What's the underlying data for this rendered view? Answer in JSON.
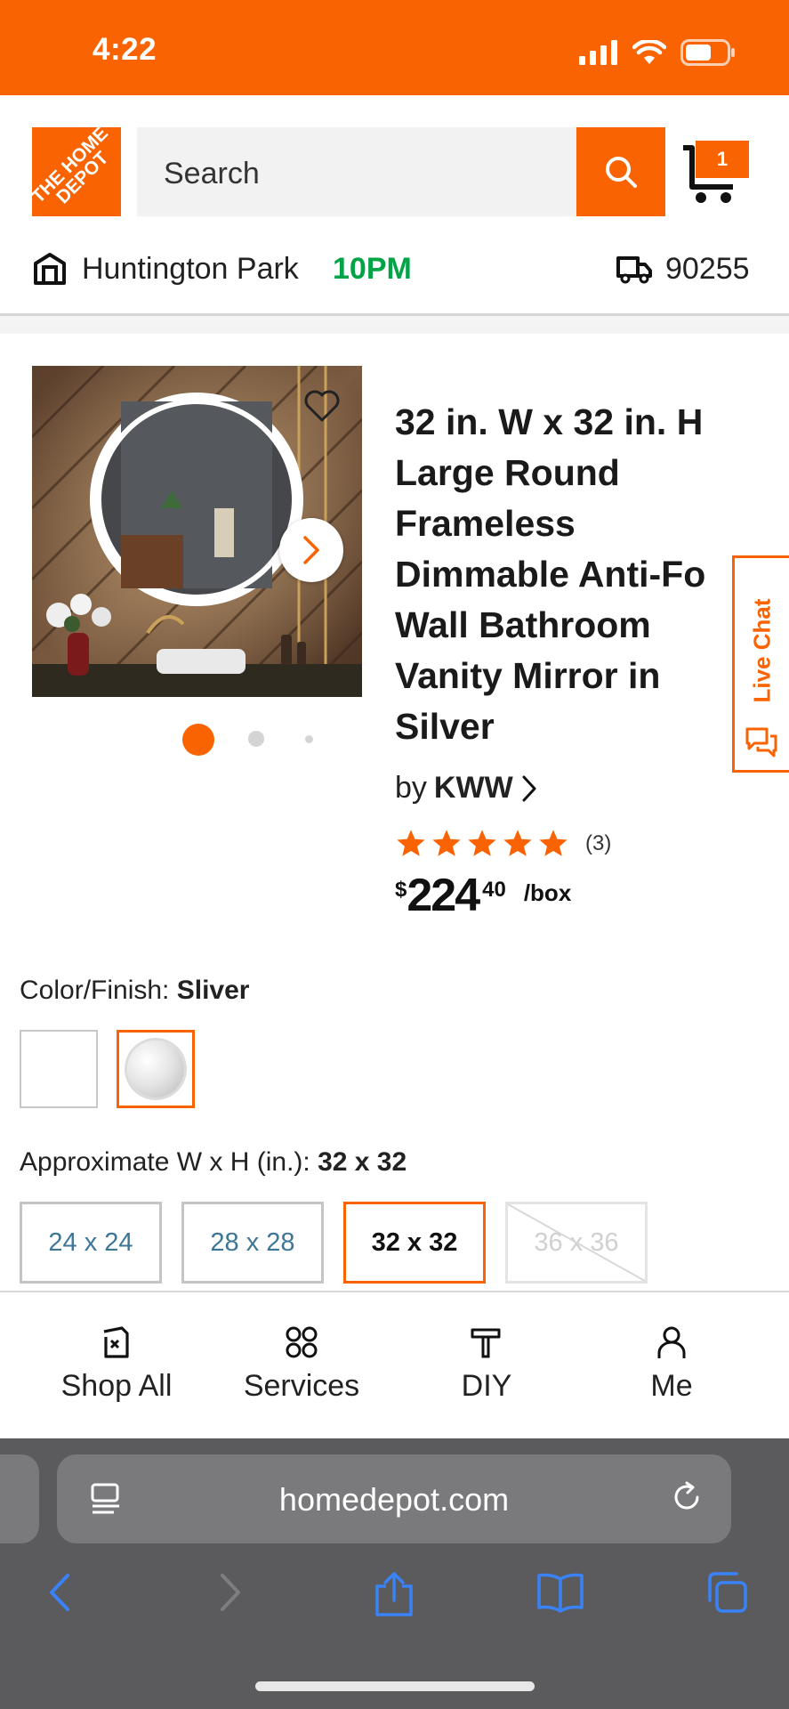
{
  "status_bar": {
    "time": "4:22"
  },
  "header": {
    "logo_text": "THE HOME DEPOT",
    "search_placeholder": "Search",
    "cart_count": "1"
  },
  "store": {
    "name": "Huntington Park",
    "hours": "10PM",
    "zip": "90255"
  },
  "product": {
    "title": "32 in. W x 32 in. H\nLarge Round\nFrameless\nDimmable Anti-Fo\nWall Bathroom\nVanity Mirror in\nSilver",
    "by": "by",
    "brand": "KWW",
    "rating_count": "(3)",
    "rating_value": 5,
    "price_symbol": "$",
    "price_dollars": "224",
    "price_cents": "40",
    "price_unit": "/box",
    "image_dots": 3,
    "active_dot": 1
  },
  "live_chat": {
    "label": "Live Chat"
  },
  "options": {
    "color_label": "Color/Finish: ",
    "color_value": "Sliver",
    "size_label": "Approximate W x H (in.): ",
    "size_value": "32 x 32",
    "sizes": [
      "24 x 24",
      "28 x 28",
      "32 x 32",
      "36 x 36"
    ]
  },
  "bottom_nav": {
    "items": [
      {
        "label": "Shop All",
        "icon": "shop-all-icon"
      },
      {
        "label": "Services",
        "icon": "services-icon"
      },
      {
        "label": "DIY",
        "icon": "diy-hammer-icon"
      },
      {
        "label": "Me",
        "icon": "person-icon"
      }
    ]
  },
  "browser": {
    "url": "homedepot.com"
  },
  "colors": {
    "brand_orange": "#f96302",
    "open_green": "#00a346",
    "link_blue": "#3e7697",
    "safari_blue": "#3a82f7"
  }
}
